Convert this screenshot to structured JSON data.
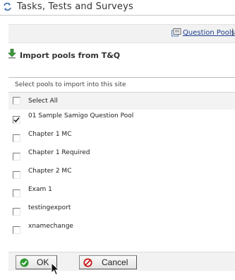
{
  "window": {
    "title": "Tasks, Tests and Surveys",
    "icon": "refresh-arrows-icon"
  },
  "toolbar": {
    "link_label": "Question Pools",
    "separator": "|",
    "icon": "question-pools-icon"
  },
  "import": {
    "title": "Import pools from T&Q",
    "icon": "import-download-icon"
  },
  "pools": {
    "header": "Select pools to import into this site",
    "select_all": {
      "label": "Select All",
      "checked": false
    },
    "items": [
      {
        "label": "01 Sample Samigo Question Pool",
        "checked": true
      },
      {
        "label": "Chapter 1 MC",
        "checked": false
      },
      {
        "label": "Chapter 1 Required",
        "checked": false
      },
      {
        "label": "Chapter 2 MC",
        "checked": false
      },
      {
        "label": "Exam 1",
        "checked": false
      },
      {
        "label": "testingexport",
        "checked": false
      },
      {
        "label": "xnamechange",
        "checked": false
      }
    ]
  },
  "buttons": {
    "ok_label": "OK",
    "cancel_label": "Cancel"
  },
  "colors": {
    "link": "#1d3f8e",
    "ok_icon": "#2f9a2f",
    "cancel_icon": "#c41818"
  }
}
